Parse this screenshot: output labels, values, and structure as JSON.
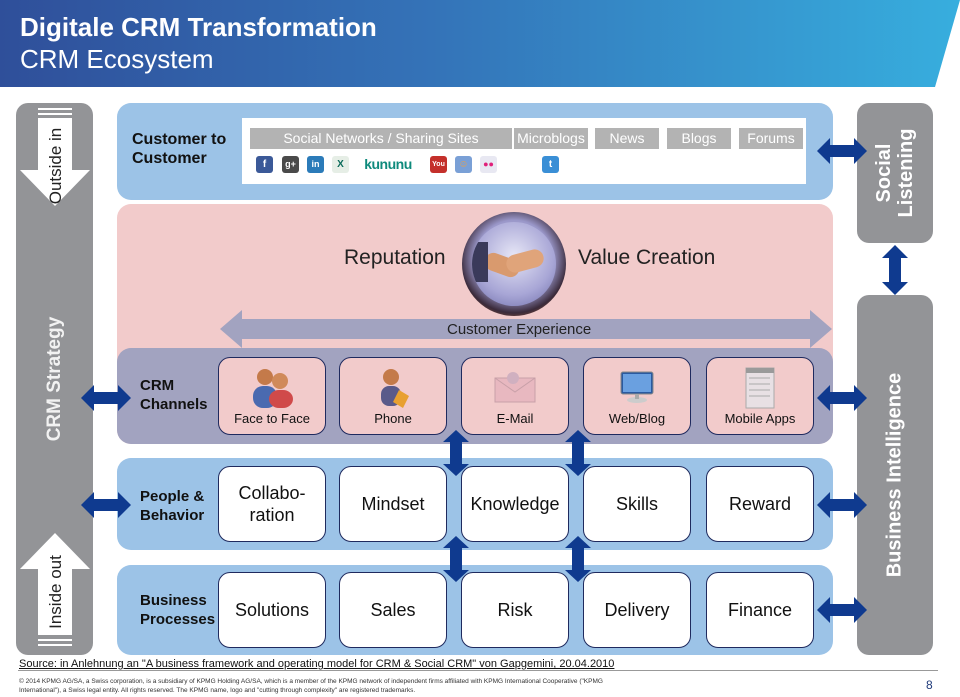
{
  "header": {
    "title": "Digitale CRM Transformation",
    "subtitle": "CRM Ecosystem"
  },
  "left_bar": {
    "top_arrow_label": "Outside in",
    "middle_label": "CRM Strategy",
    "bottom_arrow_label": "Inside out"
  },
  "right_bar": {
    "social_listening_line1": "Social",
    "social_listening_line2": "Listening",
    "business_intelligence": "Business Intelligence"
  },
  "customer_to_customer": {
    "label_line1": "Customer to",
    "label_line2": "Customer",
    "categories": [
      "Social Networks / Sharing Sites",
      "Microblogs",
      "News",
      "Blogs",
      "Forums"
    ],
    "social_icons": [
      {
        "name": "facebook",
        "glyph": "f",
        "color": "#3b5998"
      },
      {
        "name": "google-plus",
        "glyph": "g+",
        "color": "#4a4a4a"
      },
      {
        "name": "linkedin",
        "glyph": "in",
        "color": "#2b7bb9"
      },
      {
        "name": "xing",
        "glyph": "X",
        "color": "#e8f0e8"
      },
      {
        "name": "kununu",
        "glyph": "kununu",
        "color": "#0e8a7c"
      },
      {
        "name": "youtube",
        "glyph": "You",
        "color": "#c4302b"
      },
      {
        "name": "myspace",
        "glyph": "☺",
        "color": "#5a8ac6"
      },
      {
        "name": "flickr",
        "glyph": "••",
        "color": "#e8e8f0"
      },
      {
        "name": "twitter",
        "glyph": "t",
        "color": "#3a8fd6"
      }
    ]
  },
  "value_layer": {
    "left_word": "Reputation",
    "right_word": "Value Creation",
    "experience_label": "Customer Experience"
  },
  "channels": {
    "label_line1": "CRM",
    "label_line2": "Channels",
    "items": [
      "Face to Face",
      "Phone",
      "E-Mail",
      "Web/Blog",
      "Mobile Apps"
    ]
  },
  "people": {
    "label_line1": "People &",
    "label_line2": "Behavior",
    "items": [
      "Collabo-\nration",
      "Mindset",
      "Knowledge",
      "Skills",
      "Reward"
    ]
  },
  "processes": {
    "label_line1": "Business",
    "label_line2": "Processes",
    "items": [
      "Solutions",
      "Sales",
      "Risk",
      "Delivery",
      "Finance"
    ]
  },
  "footer": {
    "source": "Source: in Anlehnung an \"A business framework and operating model for CRM & Social CRM\" von Gapgemini, 20.04.2010",
    "copyright": "© 2014 KPMG AG/SA, a Swiss corporation, is a subsidiary of KPMG Holding AG/SA, which is a member of the KPMG network of independent firms affiliated with KPMG International Cooperative (\"KPMG International\"), a Swiss legal entity. All rights reserved. The KPMG name, logo and \"cutting through complexity\" are registered trademarks.",
    "page_number": "8"
  },
  "colors": {
    "arrow_blue": "#0f3a8f",
    "grey_bar": "#939497",
    "light_blue_panel": "#9cc3e7",
    "pink_panel": "#f2cbcb",
    "lavender_panel": "#a2a3c0"
  }
}
